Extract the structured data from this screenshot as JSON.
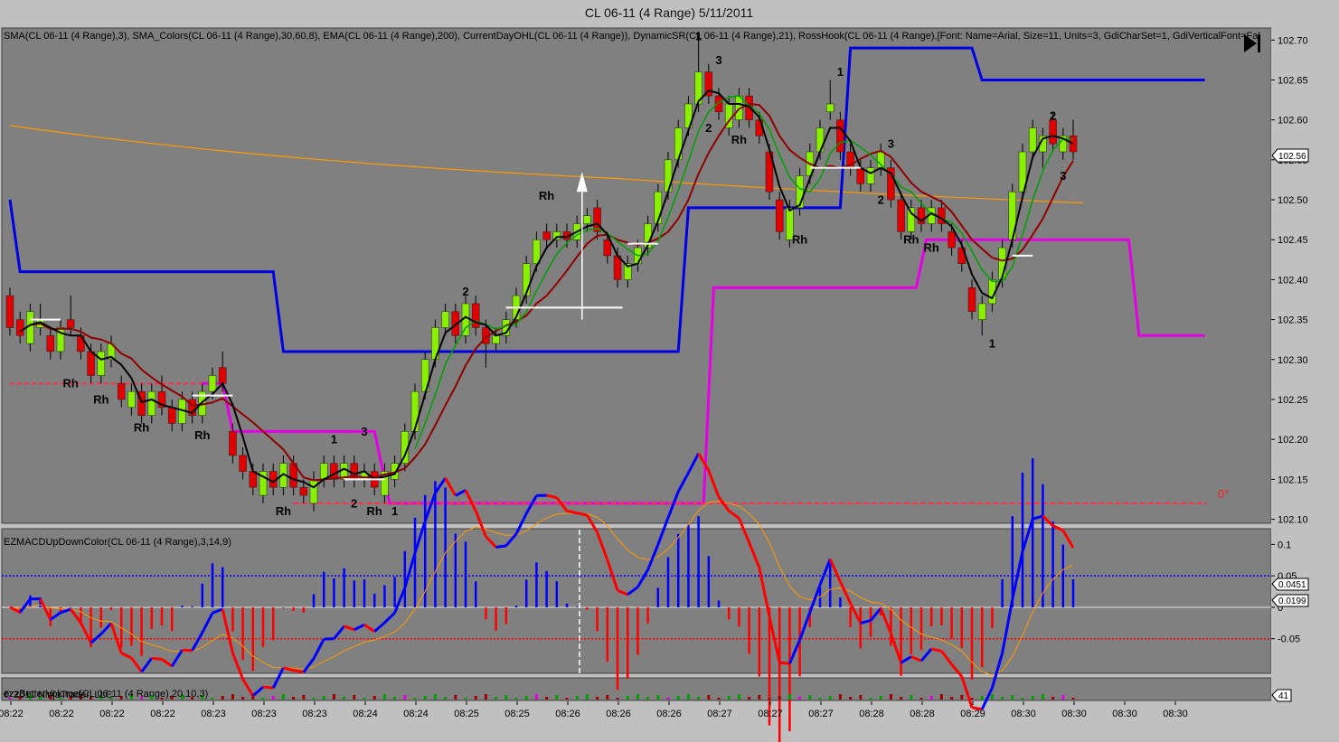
{
  "window": {
    "title": "CL 06-11 (4 Range)  5/11/2011"
  },
  "chart_data": {
    "type": "candlestick",
    "price_panel": {
      "indicators_label": "SMA(CL 06-11 (4 Range),3), SMA_Colors(CL 06-11 (4 Range),30,60,8), EMA(CL 06-11 (4 Range),200), CurrentDayOHL(CL 06-11 (4 Range)), DynamicSR(CL 06-11 (4 Range),21), RossHook(CL 06-11 (4 Range),[Font: Name=Arial, Size=11, Units=3, GdiCharSet=1, GdiVerticalFont=Fal",
      "y_ticks": [
        "102.70",
        "102.65",
        "102.60",
        "102.55",
        "102.50",
        "102.45",
        "102.40",
        "102.35",
        "102.30",
        "102.25",
        "102.20",
        "102.15",
        "102.10"
      ],
      "ylim": [
        102.095,
        102.715
      ],
      "last_price": "102.56",
      "angle_label": "0°",
      "candles": [
        [
          102.38,
          102.34,
          102.39,
          102.33
        ],
        [
          102.35,
          102.33,
          102.36,
          102.32
        ],
        [
          102.32,
          102.36,
          102.37,
          102.31
        ],
        [
          102.34,
          102.35,
          102.37,
          102.33
        ],
        [
          102.33,
          102.31,
          102.34,
          102.3
        ],
        [
          102.31,
          102.34,
          102.35,
          102.3
        ],
        [
          102.35,
          102.34,
          102.38,
          102.33
        ],
        [
          102.33,
          102.31,
          102.34,
          102.3
        ],
        [
          102.31,
          102.28,
          102.32,
          102.27
        ],
        [
          102.28,
          102.31,
          102.32,
          102.27
        ],
        [
          102.3,
          102.32,
          102.33,
          102.29
        ],
        [
          102.27,
          102.25,
          102.28,
          102.24
        ],
        [
          102.24,
          102.26,
          102.27,
          102.23
        ],
        [
          102.26,
          102.23,
          102.27,
          102.22
        ],
        [
          102.23,
          102.26,
          102.27,
          102.22
        ],
        [
          102.26,
          102.24,
          102.28,
          102.23
        ],
        [
          102.24,
          102.22,
          102.25,
          102.21
        ],
        [
          102.22,
          102.25,
          102.26,
          102.21
        ],
        [
          102.25,
          102.23,
          102.26,
          102.22
        ],
        [
          102.23,
          102.26,
          102.27,
          102.22
        ],
        [
          102.26,
          102.28,
          102.29,
          102.25
        ],
        [
          102.29,
          102.27,
          102.31,
          102.26
        ],
        [
          102.21,
          102.18,
          102.22,
          102.17
        ],
        [
          102.18,
          102.16,
          102.19,
          102.15
        ],
        [
          102.16,
          102.14,
          102.17,
          102.13
        ],
        [
          102.13,
          102.16,
          102.17,
          102.12
        ],
        [
          102.16,
          102.14,
          102.17,
          102.13
        ],
        [
          102.14,
          102.17,
          102.18,
          102.13
        ],
        [
          102.17,
          102.14,
          102.18,
          102.13
        ],
        [
          102.14,
          102.13,
          102.15,
          102.12
        ],
        [
          102.12,
          102.15,
          102.16,
          102.11
        ],
        [
          102.15,
          102.17,
          102.18,
          102.14
        ],
        [
          102.17,
          102.15,
          102.18,
          102.14
        ],
        [
          102.15,
          102.17,
          102.18,
          102.14
        ],
        [
          102.17,
          102.15,
          102.18,
          102.14
        ],
        [
          102.15,
          102.16,
          102.17,
          102.14
        ],
        [
          102.16,
          102.14,
          102.17,
          102.13
        ],
        [
          102.13,
          102.16,
          102.17,
          102.12
        ],
        [
          102.15,
          102.17,
          102.18,
          102.14
        ],
        [
          102.17,
          102.21,
          102.22,
          102.16
        ],
        [
          102.21,
          102.26,
          102.27,
          102.2
        ],
        [
          102.26,
          102.3,
          102.31,
          102.25
        ],
        [
          102.3,
          102.34,
          102.35,
          102.29
        ],
        [
          102.34,
          102.36,
          102.37,
          102.33
        ],
        [
          102.36,
          102.33,
          102.37,
          102.32
        ],
        [
          102.33,
          102.37,
          102.38,
          102.32
        ],
        [
          102.37,
          102.34,
          102.38,
          102.33
        ],
        [
          102.34,
          102.32,
          102.35,
          102.29
        ],
        [
          102.32,
          102.33,
          102.34,
          102.31
        ],
        [
          102.33,
          102.35,
          102.36,
          102.32
        ],
        [
          102.35,
          102.38,
          102.39,
          102.34
        ],
        [
          102.38,
          102.42,
          102.43,
          102.37
        ],
        [
          102.42,
          102.45,
          102.46,
          102.41
        ],
        [
          102.46,
          102.45,
          102.47,
          102.44
        ],
        [
          102.45,
          102.46,
          102.47,
          102.44
        ],
        [
          102.46,
          102.45,
          102.47,
          102.44
        ],
        [
          102.45,
          102.47,
          102.48,
          102.44
        ],
        [
          102.47,
          102.48,
          102.49,
          102.46
        ],
        [
          102.49,
          102.46,
          102.5,
          102.45
        ],
        [
          102.45,
          102.43,
          102.46,
          102.42
        ],
        [
          102.43,
          102.4,
          102.44,
          102.39
        ],
        [
          102.4,
          102.42,
          102.43,
          102.39
        ],
        [
          102.42,
          102.44,
          102.45,
          102.41
        ],
        [
          102.44,
          102.47,
          102.48,
          102.43
        ],
        [
          102.47,
          102.51,
          102.52,
          102.46
        ],
        [
          102.51,
          102.55,
          102.56,
          102.5
        ],
        [
          102.55,
          102.59,
          102.6,
          102.54
        ],
        [
          102.59,
          102.62,
          102.63,
          102.58
        ],
        [
          102.62,
          102.66,
          102.7,
          102.61
        ],
        [
          102.66,
          102.63,
          102.67,
          102.62
        ],
        [
          102.63,
          102.61,
          102.64,
          102.6
        ],
        [
          102.59,
          102.62,
          102.63,
          102.58
        ],
        [
          102.6,
          102.63,
          102.64,
          102.59
        ],
        [
          102.63,
          102.6,
          102.64,
          102.59
        ],
        [
          102.6,
          102.58,
          102.61,
          102.57
        ],
        [
          102.56,
          102.51,
          102.57,
          102.5
        ],
        [
          102.5,
          102.46,
          102.51,
          102.45
        ],
        [
          102.45,
          102.49,
          102.5,
          102.44
        ],
        [
          102.49,
          102.53,
          102.54,
          102.48
        ],
        [
          102.53,
          102.56,
          102.57,
          102.52
        ],
        [
          102.56,
          102.59,
          102.6,
          102.55
        ],
        [
          102.61,
          102.62,
          102.65,
          102.6
        ],
        [
          102.6,
          102.56,
          102.61,
          102.55
        ],
        [
          102.56,
          102.54,
          102.57,
          102.53
        ],
        [
          102.54,
          102.52,
          102.55,
          102.51
        ],
        [
          102.52,
          102.54,
          102.55,
          102.51
        ],
        [
          102.54,
          102.56,
          102.57,
          102.53
        ],
        [
          102.54,
          102.5,
          102.55,
          102.49
        ],
        [
          102.5,
          102.46,
          102.51,
          102.45
        ],
        [
          102.46,
          102.49,
          102.5,
          102.45
        ],
        [
          102.49,
          102.47,
          102.5,
          102.46
        ],
        [
          102.47,
          102.49,
          102.5,
          102.46
        ],
        [
          102.49,
          102.47,
          102.5,
          102.46
        ],
        [
          102.46,
          102.44,
          102.47,
          102.43
        ],
        [
          102.44,
          102.42,
          102.45,
          102.41
        ],
        [
          102.39,
          102.36,
          102.4,
          102.35
        ],
        [
          102.35,
          102.37,
          102.38,
          102.33
        ],
        [
          102.37,
          102.4,
          102.41,
          102.36
        ],
        [
          102.4,
          102.44,
          102.45,
          102.39
        ],
        [
          102.45,
          102.51,
          102.52,
          102.44
        ],
        [
          102.51,
          102.56,
          102.57,
          102.5
        ],
        [
          102.56,
          102.59,
          102.6,
          102.55
        ],
        [
          102.56,
          102.58,
          102.59,
          102.54
        ],
        [
          102.6,
          102.57,
          102.61,
          102.56
        ],
        [
          102.56,
          102.58,
          102.59,
          102.55
        ],
        [
          102.58,
          102.56,
          102.6,
          102.55
        ]
      ],
      "annotations": [
        {
          "text": "Rh",
          "price": 102.265,
          "bar": 6
        },
        {
          "text": "Rh",
          "price": 102.245,
          "bar": 9
        },
        {
          "text": "Rh",
          "price": 102.21,
          "bar": 13
        },
        {
          "text": "Rh",
          "price": 102.2,
          "bar": 19
        },
        {
          "text": "Rh",
          "price": 102.105,
          "bar": 27
        },
        {
          "text": "2",
          "price": 102.115,
          "bar": 34
        },
        {
          "text": "Rh",
          "price": 102.105,
          "bar": 36
        },
        {
          "text": "1",
          "price": 102.105,
          "bar": 38
        },
        {
          "text": "1",
          "price": 102.195,
          "bar": 32
        },
        {
          "text": "3",
          "price": 102.205,
          "bar": 35
        },
        {
          "text": "2",
          "price": 102.38,
          "bar": 45
        },
        {
          "text": "Rh",
          "price": 102.5,
          "bar": 53
        },
        {
          "text": "1",
          "price": 102.7,
          "bar": 68
        },
        {
          "text": "3",
          "price": 102.67,
          "bar": 70
        },
        {
          "text": "2",
          "price": 102.585,
          "bar": 69
        },
        {
          "text": "Rh",
          "price": 102.57,
          "bar": 72
        },
        {
          "text": "Rh",
          "price": 102.445,
          "bar": 78
        },
        {
          "text": "1",
          "price": 102.655,
          "bar": 82
        },
        {
          "text": "3",
          "price": 102.565,
          "bar": 87
        },
        {
          "text": "2",
          "price": 102.495,
          "bar": 86
        },
        {
          "text": "Rh",
          "price": 102.445,
          "bar": 89
        },
        {
          "text": "Rh",
          "price": 102.435,
          "bar": 91
        },
        {
          "text": "1",
          "price": 102.315,
          "bar": 97
        },
        {
          "text": "2",
          "price": 102.6,
          "bar": 103
        },
        {
          "text": "3",
          "price": 102.525,
          "bar": 104
        }
      ]
    },
    "macd_panel": {
      "label": "EZMACDUpDownColor(CL 06-11 (4 Range),3,14,9)",
      "y_ticks": [
        "0.1",
        "0.05",
        "0",
        "-0.05"
      ],
      "ylim": [
        -0.105,
        0.125
      ],
      "value_a": "0.0451",
      "value_b": "0.0199",
      "dotted_upper": 0.05,
      "dotted_lower": -0.05
    },
    "volume_panel": {
      "label": "ezzBetterVolume(CL 06-11 (4 Range),20,10,3)",
      "sub_label": "© 2011 NinjaTrader, LLC",
      "value": "41"
    },
    "x_ticks": [
      "08:22",
      "08:22",
      "08:22",
      "08:22",
      "08:23",
      "08:23",
      "08:23",
      "08:24",
      "08:24",
      "08:25",
      "08:25",
      "08:26",
      "08:26",
      "08:26",
      "08:27",
      "08:27",
      "08:27",
      "08:28",
      "08:28",
      "08:29",
      "08:30",
      "08:30",
      "08:30",
      "08:30"
    ],
    "colors": {
      "up": "#88f000",
      "down": "#e00000",
      "sr_blue": "#0000e6",
      "sr_magenta": "#e600e6",
      "ema200": "#ff9900",
      "sma_fast": "#000000",
      "sma_slow": "#900000",
      "sma_green": "#00a000",
      "macd_blue": "#0000ff",
      "macd_red": "#ff0000",
      "panel_bg": "#808080",
      "frame_bg": "#c0c0c0"
    }
  }
}
